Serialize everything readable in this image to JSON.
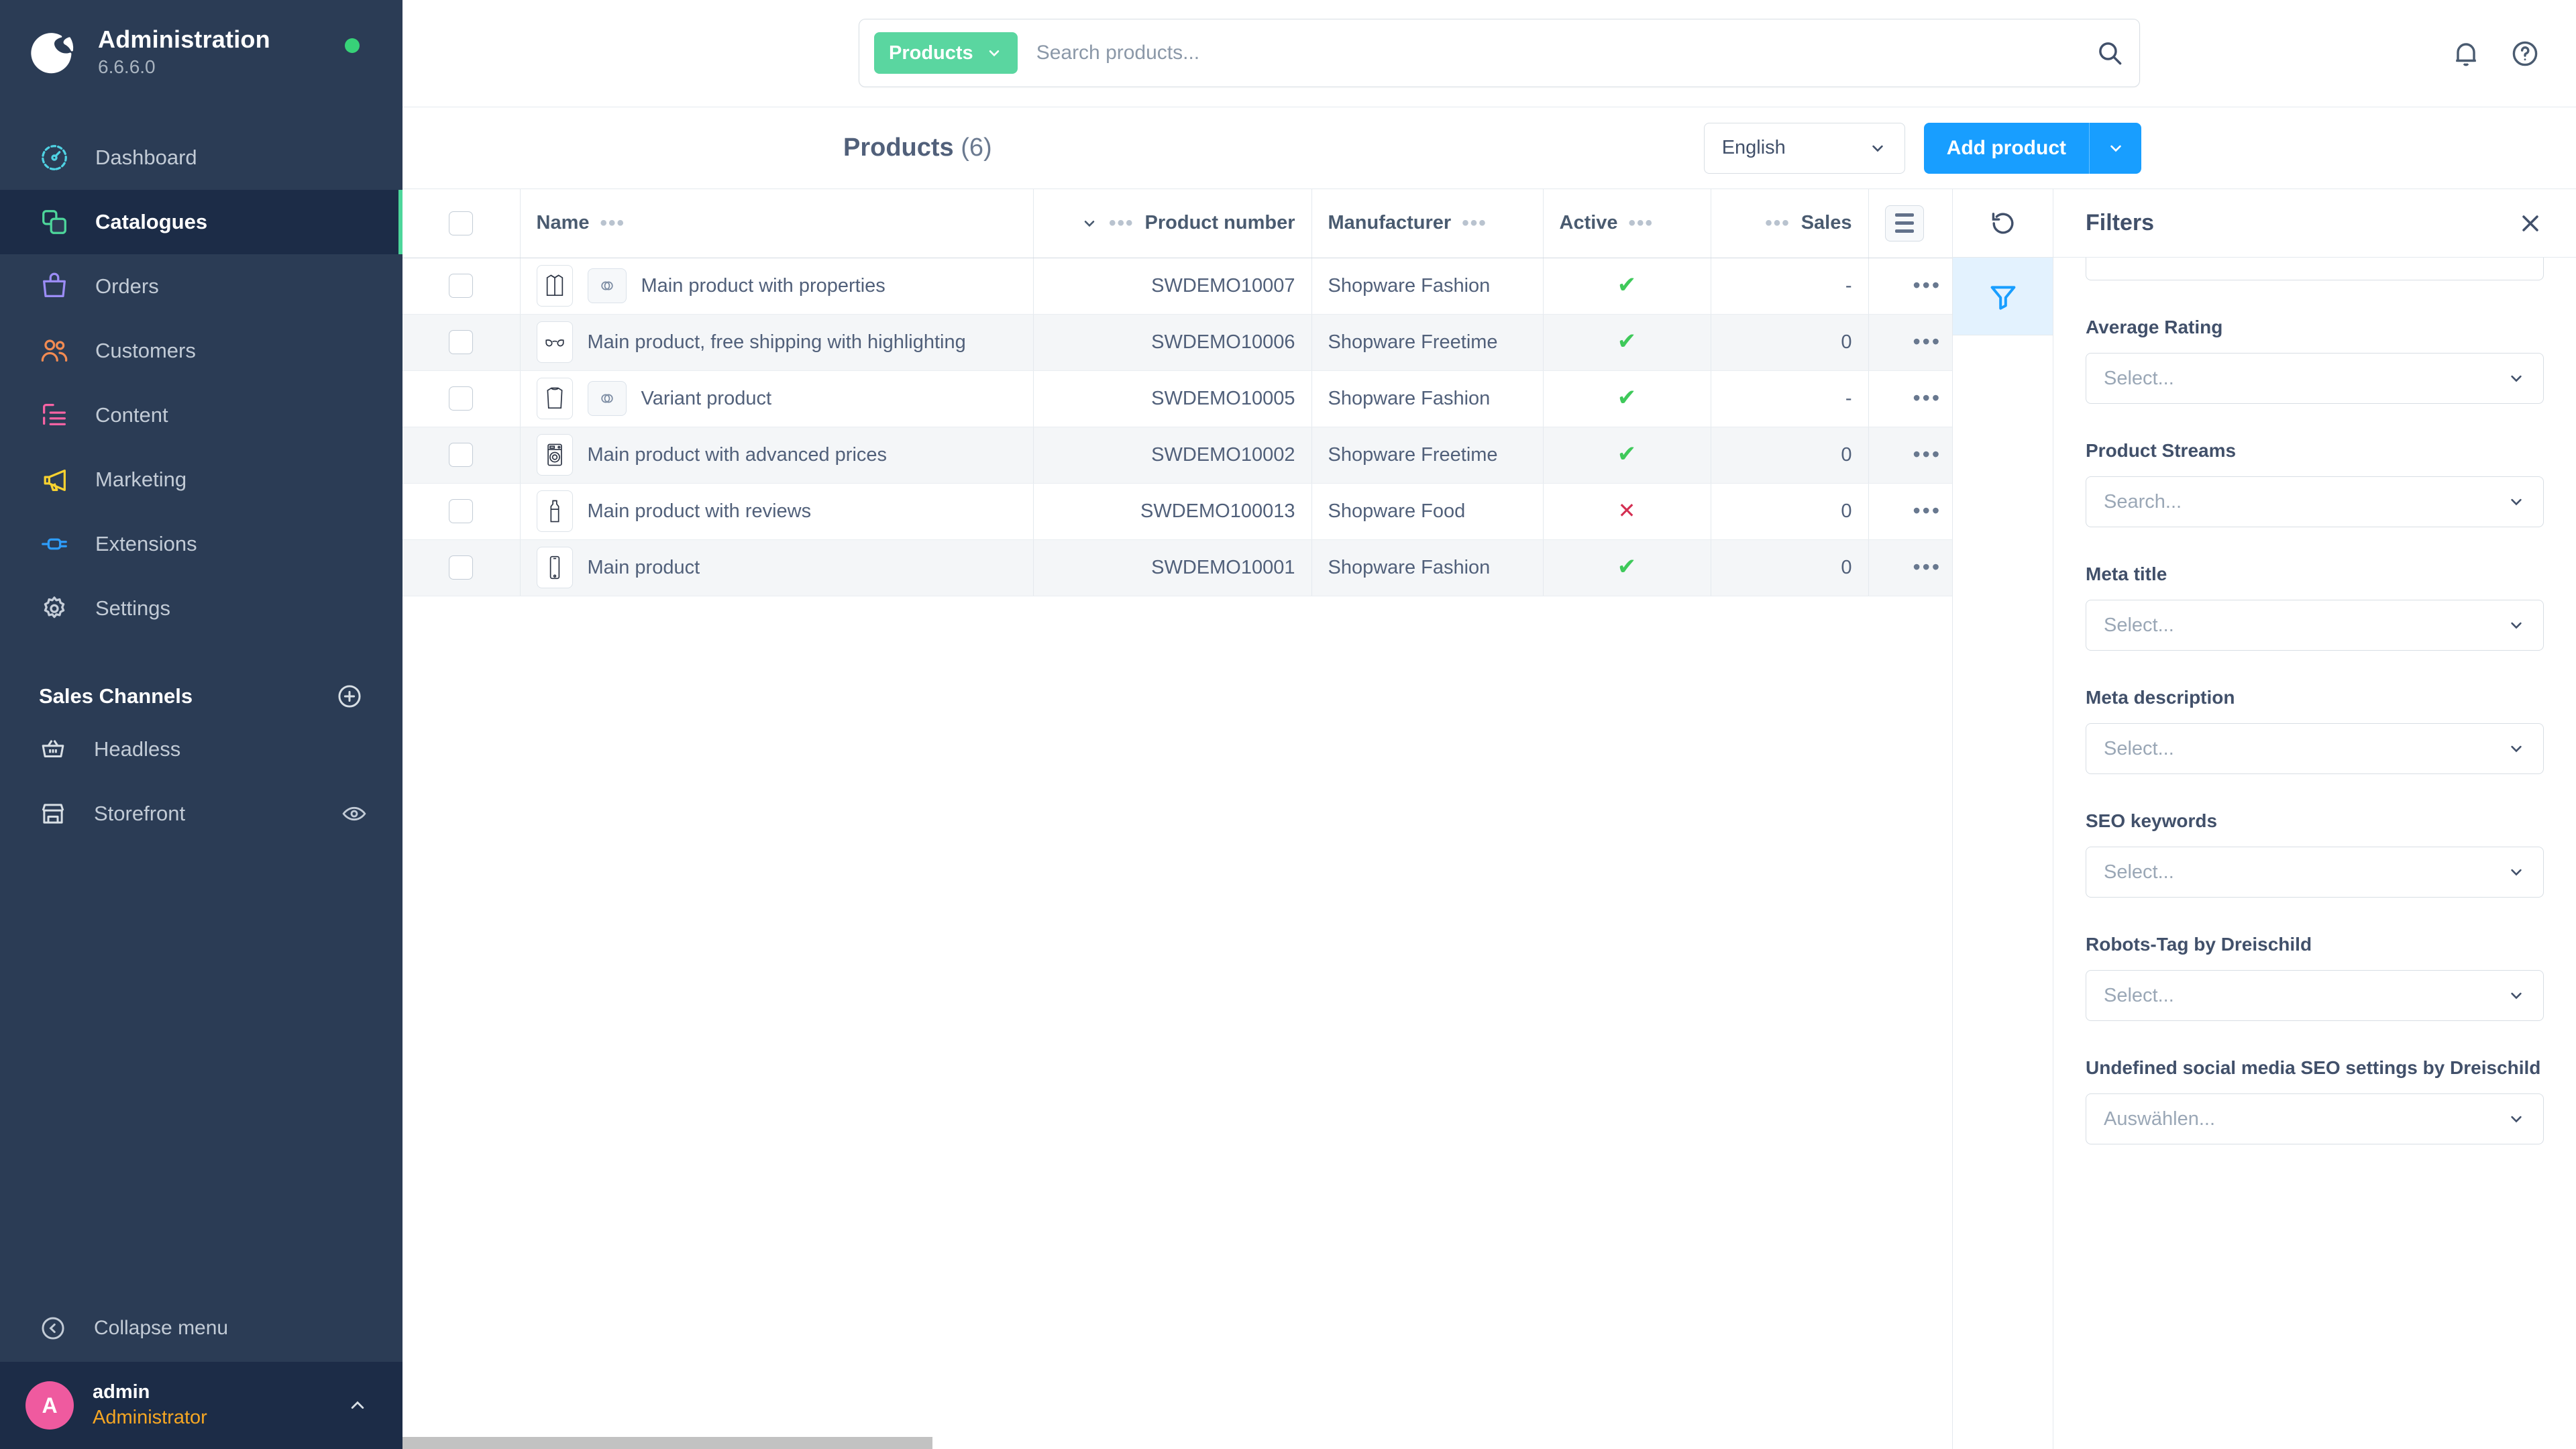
{
  "sidebar": {
    "brand": {
      "title": "Administration",
      "version": "6.6.6.0",
      "status_color": "#37d278"
    },
    "items": [
      {
        "label": "Dashboard",
        "icon": "speedometer-icon",
        "color": "#4fd2e3",
        "active": false
      },
      {
        "label": "Catalogues",
        "icon": "catalogues-icon",
        "color": "#4dd69b",
        "active": true
      },
      {
        "label": "Orders",
        "icon": "bag-icon",
        "color": "#9b8cf5",
        "active": false
      },
      {
        "label": "Customers",
        "icon": "users-icon",
        "color": "#f28b52",
        "active": false
      },
      {
        "label": "Content",
        "icon": "content-icon",
        "color": "#f863a4",
        "active": false
      },
      {
        "label": "Marketing",
        "icon": "megaphone-icon",
        "color": "#f7d130",
        "active": false
      },
      {
        "label": "Extensions",
        "icon": "plug-icon",
        "color": "#2e9dfb",
        "active": false
      },
      {
        "label": "Settings",
        "icon": "gear-icon",
        "color": "#c6ced9",
        "active": false
      }
    ],
    "sales_channels": {
      "title": "Sales Channels",
      "add_icon": "plus-circle-icon",
      "items": [
        {
          "label": "Headless",
          "icon": "basket-icon",
          "trailing_icon": ""
        },
        {
          "label": "Storefront",
          "icon": "store-icon",
          "trailing_icon": "eye-icon"
        }
      ]
    },
    "collapse": {
      "label": "Collapse menu",
      "icon": "chevron-left-circle-icon"
    },
    "user": {
      "initial": "A",
      "name": "admin",
      "role": "Administrator",
      "avatar_color": "#ef5a9f",
      "caret_icon": "chevron-up-icon"
    }
  },
  "topbar": {
    "search": {
      "badge_label": "Products",
      "badge_color": "#5ad6a0",
      "placeholder": "Search products...",
      "value": "",
      "search_icon": "search-icon"
    },
    "notification_icon": "bell-icon",
    "help_icon": "help-circle-icon"
  },
  "pagehead": {
    "title": "Products",
    "count": "(6)",
    "language": {
      "value": "English",
      "caret_icon": "chevron-down-icon"
    },
    "add_button": {
      "label": "Add product",
      "color": "#189eff",
      "caret_icon": "chevron-down-icon"
    }
  },
  "table": {
    "columns": [
      {
        "key": "check",
        "label": ""
      },
      {
        "key": "name",
        "label": "Name"
      },
      {
        "key": "product_number",
        "label": "Product number"
      },
      {
        "key": "manufacturer",
        "label": "Manufacturer"
      },
      {
        "key": "active",
        "label": "Active"
      },
      {
        "key": "sales",
        "label": "Sales"
      },
      {
        "key": "actions",
        "label": ""
      }
    ],
    "rows": [
      {
        "name": "Main product with properties",
        "thumb": "shirt-icon",
        "variant_badge": true,
        "product_number": "SWDEMO10007",
        "manufacturer": "Shopware Fashion",
        "active": true,
        "sales": "-",
        "actions_icon": "more-icon"
      },
      {
        "name": "Main product, free shipping with highlighting",
        "thumb": "glasses-icon",
        "variant_badge": false,
        "product_number": "SWDEMO10006",
        "manufacturer": "Shopware Freetime",
        "active": true,
        "sales": "0",
        "actions_icon": "more-icon"
      },
      {
        "name": "Variant product",
        "thumb": "sweater-icon",
        "variant_badge": true,
        "product_number": "SWDEMO10005",
        "manufacturer": "Shopware Fashion",
        "active": true,
        "sales": "-",
        "actions_icon": "more-icon"
      },
      {
        "name": "Main product with advanced prices",
        "thumb": "washer-icon",
        "variant_badge": false,
        "product_number": "SWDEMO10002",
        "manufacturer": "Shopware Freetime",
        "active": true,
        "sales": "0",
        "actions_icon": "more-icon"
      },
      {
        "name": "Main product with reviews",
        "thumb": "bottle-icon",
        "variant_badge": false,
        "product_number": "SWDEMO100013",
        "manufacturer": "Shopware Food",
        "active": false,
        "sales": "0",
        "actions_icon": "more-icon"
      },
      {
        "name": "Main product",
        "thumb": "phone-icon",
        "variant_badge": false,
        "product_number": "SWDEMO10001",
        "manufacturer": "Shopware Fashion",
        "active": true,
        "sales": "0",
        "actions_icon": "more-icon"
      }
    ],
    "column_settings_icon": "list-settings-icon",
    "active_true_glyph": "✔",
    "active_false_glyph": "✕"
  },
  "rail": {
    "refresh_icon": "refresh-icon",
    "filter_icon": "filter-icon",
    "filter_active": true,
    "filter_active_color": "#189eff"
  },
  "filters": {
    "title": "Filters",
    "close_icon": "close-icon",
    "fields": [
      {
        "label": "Average Rating",
        "placeholder": "Select...",
        "caret_icon": "chevron-down-icon"
      },
      {
        "label": "Product Streams",
        "placeholder": "Search...",
        "caret_icon": "chevron-down-icon"
      },
      {
        "label": "Meta title",
        "placeholder": "Select...",
        "caret_icon": "chevron-down-icon"
      },
      {
        "label": "Meta description",
        "placeholder": "Select...",
        "caret_icon": "chevron-down-icon"
      },
      {
        "label": "SEO keywords",
        "placeholder": "Select...",
        "caret_icon": "chevron-down-icon"
      },
      {
        "label": "Robots-Tag by Dreischild",
        "placeholder": "Select...",
        "caret_icon": "chevron-down-icon"
      },
      {
        "label": "Undefined social media SEO settings by Dreischild",
        "placeholder": "Auswählen...",
        "caret_icon": "chevron-down-icon"
      }
    ]
  }
}
